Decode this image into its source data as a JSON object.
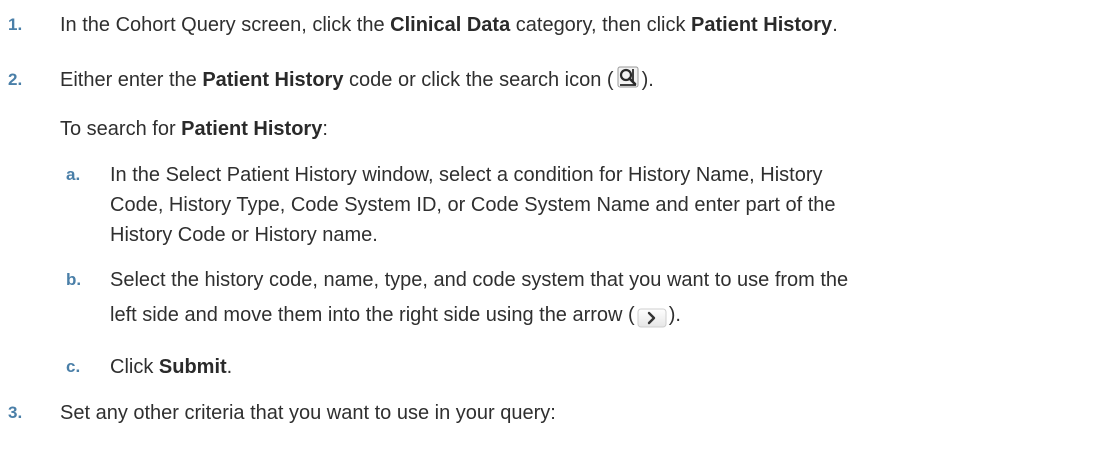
{
  "steps": [
    {
      "num": "1.",
      "pre": "In the Cohort Query screen, click the ",
      "b1": "Clinical Data",
      "mid": " category, then click ",
      "b2": "Patient History",
      "post": "."
    },
    {
      "num": "2.",
      "pre": "Either enter the ",
      "b1": "Patient History",
      "mid": " code or click the search icon (",
      "post": ").",
      "icon": "search-icon"
    }
  ],
  "search_intro": {
    "pre": "To search for ",
    "b": "Patient History",
    "post": ":"
  },
  "substeps": [
    {
      "num": "a.",
      "lines": [
        "In the Select Patient History window, select a condition for History Name, History",
        "Code, History Type, Code System ID, or Code System Name and enter part of the",
        "History Code or History name."
      ]
    },
    {
      "num": "b.",
      "line1": "Select the history code, name, type, and code system that you want to use from the",
      "line2_pre": "left side and move them into the right side using the arrow (",
      "line2_post": ").",
      "icon": "arrow-right-icon"
    },
    {
      "num": "c.",
      "pre": "Click ",
      "b": "Submit",
      "post": "."
    }
  ],
  "step3": {
    "num": "3.",
    "text": "Set any other criteria that you want to use in your query:"
  }
}
